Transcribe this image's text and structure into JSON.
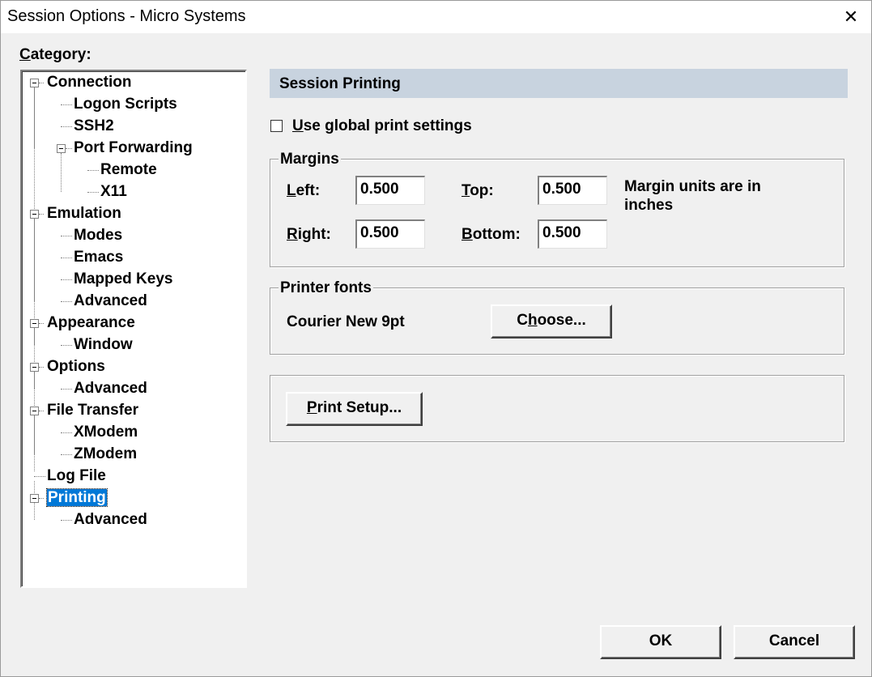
{
  "window": {
    "title": "Session Options - Micro Systems",
    "close_glyph": "✕"
  },
  "category_label": "Category:",
  "tree": [
    {
      "label": "Connection",
      "level": 0,
      "expandable": true
    },
    {
      "label": "Logon Scripts",
      "level": 1
    },
    {
      "label": "SSH2",
      "level": 1
    },
    {
      "label": "Port Forwarding",
      "level": 1,
      "expandable": true
    },
    {
      "label": "Remote",
      "level": 2
    },
    {
      "label": "X11",
      "level": 2
    },
    {
      "label": "Emulation",
      "level": 0,
      "expandable": true
    },
    {
      "label": "Modes",
      "level": 1
    },
    {
      "label": "Emacs",
      "level": 1
    },
    {
      "label": "Mapped Keys",
      "level": 1
    },
    {
      "label": "Advanced",
      "level": 1
    },
    {
      "label": "Appearance",
      "level": 0,
      "expandable": true
    },
    {
      "label": "Window",
      "level": 1
    },
    {
      "label": "Options",
      "level": 0,
      "expandable": true
    },
    {
      "label": "Advanced",
      "level": 1
    },
    {
      "label": "File Transfer",
      "level": 0,
      "expandable": true
    },
    {
      "label": "XModem",
      "level": 1
    },
    {
      "label": "ZModem",
      "level": 1
    },
    {
      "label": "Log File",
      "level": 0
    },
    {
      "label": "Printing",
      "level": 0,
      "expandable": true,
      "selected": true
    },
    {
      "label": "Advanced",
      "level": 1
    }
  ],
  "panel": {
    "header": "Session Printing",
    "use_global": {
      "label": "Use global print settings",
      "checked": false
    },
    "margins": {
      "legend": "Margins",
      "left_label": "Left:",
      "left_value": "0.500",
      "top_label": "Top:",
      "top_value": "0.500",
      "right_label": "Right:",
      "right_value": "0.500",
      "bottom_label": "Bottom:",
      "bottom_value": "0.500",
      "units_note_line1": "Margin units are in",
      "units_note_line2": "inches"
    },
    "fonts": {
      "legend": "Printer fonts",
      "current": "Courier New 9pt",
      "choose_label": "Choose..."
    },
    "print_setup_label": "Print Setup..."
  },
  "buttons": {
    "ok": "OK",
    "cancel": "Cancel"
  }
}
